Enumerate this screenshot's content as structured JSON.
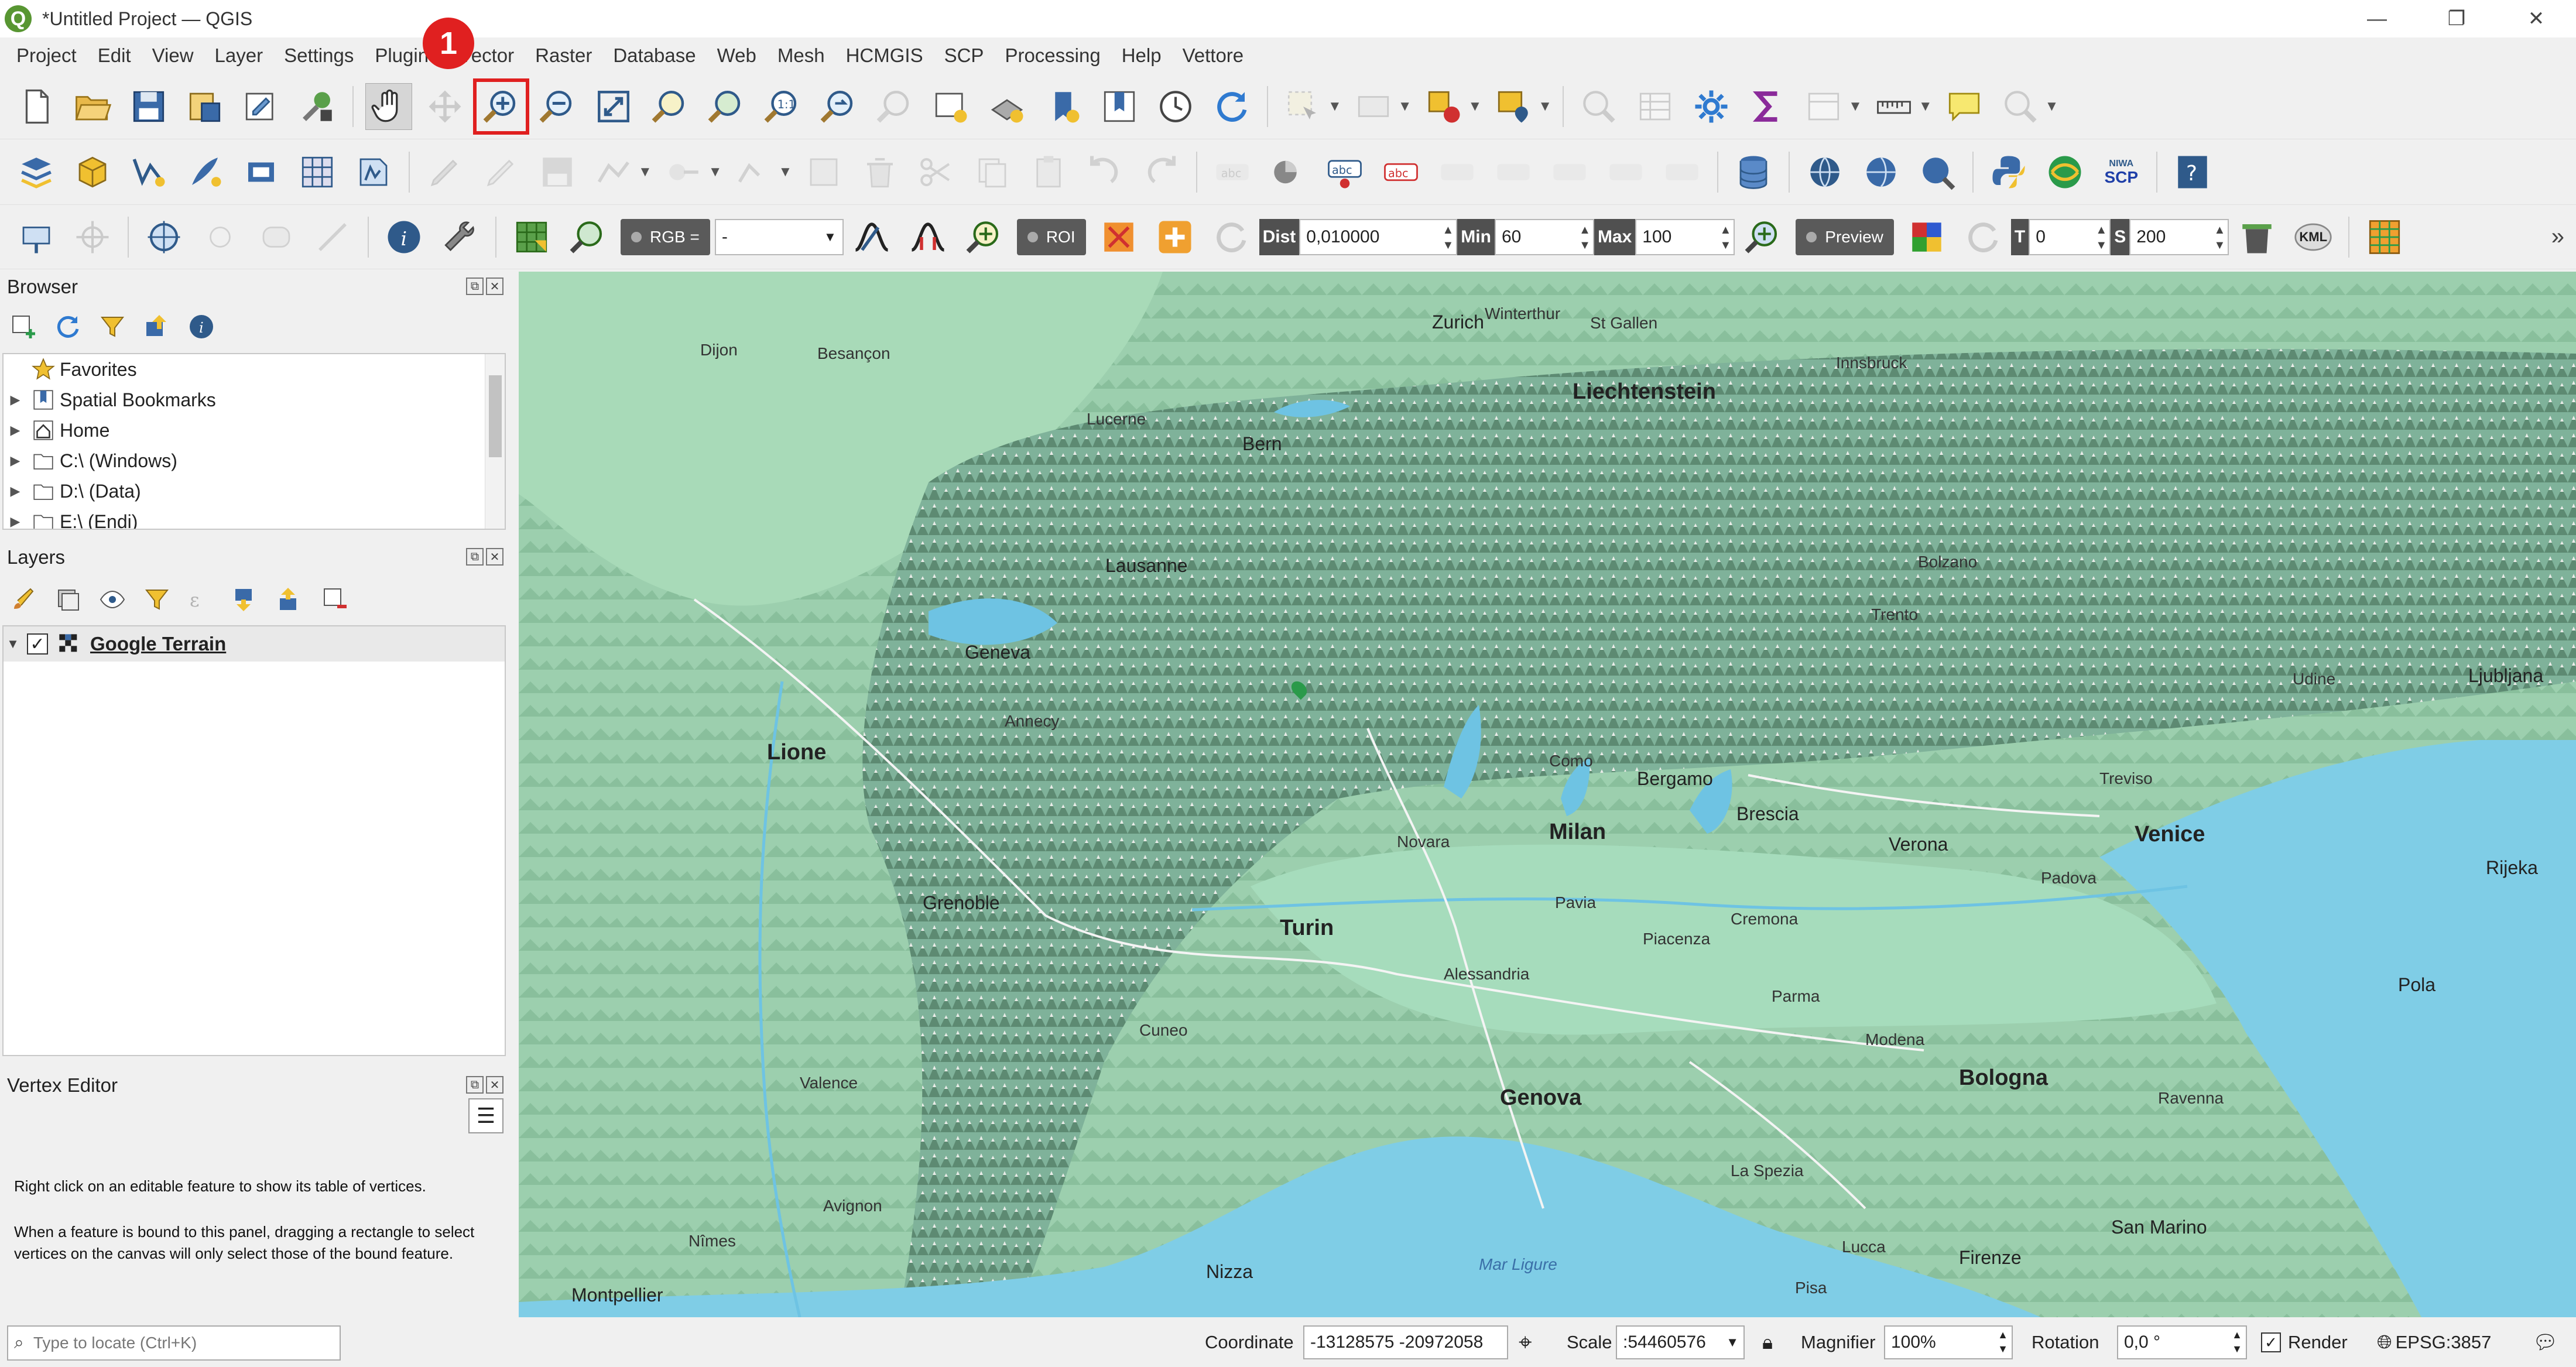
{
  "window": {
    "title": "*Untitled Project — QGIS",
    "logo": "Q",
    "minimize": "—",
    "maximize": "❐",
    "close": "✕"
  },
  "menu": [
    "Project",
    "Edit",
    "View",
    "Layer",
    "Settings",
    "Plugins",
    "Vector",
    "Raster",
    "Database",
    "Web",
    "Mesh",
    "HCMGIS",
    "SCP",
    "Processing",
    "Help",
    "Vettore"
  ],
  "callout": {
    "number": "1",
    "target": "zoom-in-button"
  },
  "scp_toolbar": {
    "rgb_label": "RGB =",
    "rgb_value": "-",
    "roi_label": "ROI",
    "dist_label": "Dist",
    "dist_value": "0,010000",
    "min_label": "Min",
    "min_value": "60",
    "max_label": "Max",
    "max_value": "100",
    "preview_label": "Preview",
    "t_label": "T",
    "t_value": "0",
    "s_label": "S",
    "s_value": "200",
    "kml_label": "KML",
    "niwa_label": "NIWA",
    "scp_label": "SCP",
    "overflow": "»"
  },
  "browser": {
    "title": "Browser",
    "items": [
      {
        "label": "Favorites",
        "icon": "star-icon",
        "expandable": false
      },
      {
        "label": "Spatial Bookmarks",
        "icon": "bookmark-icon",
        "expandable": true
      },
      {
        "label": "Home",
        "icon": "home-icon",
        "expandable": true
      },
      {
        "label": "C:\\ (Windows)",
        "icon": "drive-icon",
        "expandable": true
      },
      {
        "label": "D:\\ (Data)",
        "icon": "drive-icon",
        "expandable": true
      },
      {
        "label": "E:\\ (Endi)",
        "icon": "drive-icon",
        "expandable": true
      }
    ]
  },
  "layers": {
    "title": "Layers",
    "items": [
      {
        "name": "Google Terrain",
        "checked": true
      }
    ]
  },
  "vertex_editor": {
    "title": "Vertex Editor",
    "hint1": "Right click on an editable feature to show its table of vertices.",
    "hint2": "When a feature is bound to this panel, dragging a rectangle to select vertices on the canvas will only select those of the bound feature."
  },
  "map": {
    "layer": "Google Terrain",
    "places": {
      "liechtenstein": "Liechtenstein",
      "zurich": "Zurich",
      "bern": "Bern",
      "lausanne": "Lausanne",
      "geneva": "Geneva",
      "lione": "Lione",
      "grenoble": "Grenoble",
      "turin": "Turin",
      "milan": "Milan",
      "venice": "Venice",
      "genova": "Genova",
      "nizza": "Nizza",
      "montpellier": "Montpellier",
      "bologna": "Bologna",
      "firenze": "Firenze",
      "ljubljana": "Ljubljana",
      "verona": "Verona",
      "brescia": "Brescia",
      "bergamo": "Bergamo",
      "parma": "Parma",
      "modena": "Modena",
      "rijeka": "Rijeka",
      "pola": "Pola",
      "san_marino": "San Marino",
      "ravenna": "Ravenna",
      "padova": "Padova",
      "trento": "Trento",
      "bolzano": "Bolzano",
      "innsbruck": "Innsbruck",
      "annecy": "Annecy",
      "besancon": "Besançon",
      "dijon": "Dijon",
      "lucerne": "Lucerne",
      "como": "Como",
      "novara": "Novara",
      "pavia": "Pavia",
      "piacenza": "Piacenza",
      "alessandria": "Alessandria",
      "cremona": "Cremona",
      "lucca": "Lucca",
      "pisa": "Pisa",
      "la_spezia": "La Spezia",
      "valence": "Valence",
      "nimes": "Nîmes",
      "avignon": "Avignon",
      "st_gallen": "St Gallen",
      "winterthur": "Winterthur",
      "treviso": "Treviso",
      "udine": "Udine",
      "cuneo": "Cuneo",
      "mar_ligure": "Mar Ligure"
    }
  },
  "status": {
    "locator_placeholder": "Type to locate (Ctrl+K)",
    "coordinate_label": "Coordinate",
    "coordinate_value": "-13128575  -20972058",
    "scale_label": "Scale",
    "scale_value": ":54460576",
    "magnifier_label": "Magnifier",
    "magnifier_value": "100%",
    "rotation_label": "Rotation",
    "rotation_value": "0,0 °",
    "render_label": "Render",
    "render_checked": true,
    "crs_label": "EPSG:3857"
  }
}
